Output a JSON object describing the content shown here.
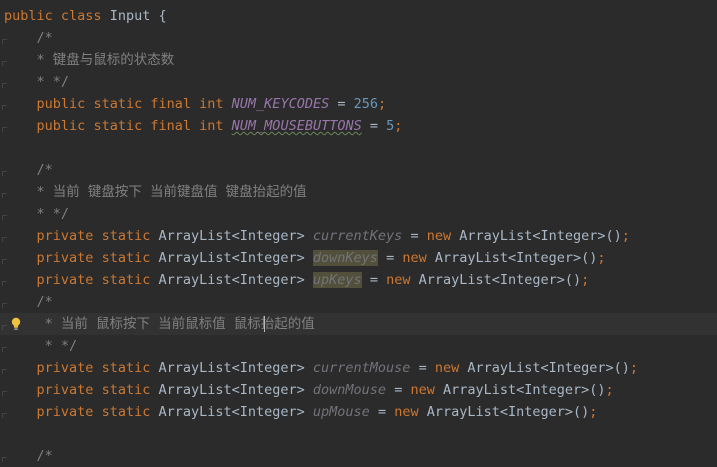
{
  "lines": [
    {
      "t": [
        [
          "public",
          "kw"
        ],
        [
          " ",
          ""
        ],
        [
          "class",
          "kw"
        ],
        [
          " ",
          ""
        ],
        [
          "Input",
          "cname"
        ],
        [
          " {",
          ""
        ]
      ]
    },
    {
      "t": [
        [
          "    /*",
          "cm"
        ]
      ]
    },
    {
      "t": [
        [
          "    * 键盘与鼠标的状态数",
          "cm"
        ]
      ]
    },
    {
      "t": [
        [
          "    * */",
          "cm"
        ]
      ]
    },
    {
      "t": [
        [
          "    ",
          ""
        ],
        [
          "public",
          "kw"
        ],
        [
          " ",
          ""
        ],
        [
          "static",
          "kw"
        ],
        [
          " ",
          ""
        ],
        [
          "final",
          "kw"
        ],
        [
          " ",
          ""
        ],
        [
          "int",
          "kw"
        ],
        [
          " ",
          ""
        ],
        [
          "NUM_KEYCODES",
          "fstatic"
        ],
        [
          " = ",
          ""
        ],
        [
          "256",
          "num"
        ],
        [
          ";",
          "kw"
        ]
      ]
    },
    {
      "t": [
        [
          "    ",
          ""
        ],
        [
          "public",
          "kw"
        ],
        [
          " ",
          ""
        ],
        [
          "static",
          "kw"
        ],
        [
          " ",
          ""
        ],
        [
          "final",
          "kw"
        ],
        [
          " ",
          ""
        ],
        [
          "int",
          "kw"
        ],
        [
          " ",
          ""
        ],
        [
          "NUM_MOUSEBUTTONS",
          "fstatic ul"
        ],
        [
          " = ",
          ""
        ],
        [
          "5",
          "num"
        ],
        [
          ";",
          "kw"
        ]
      ]
    },
    {
      "t": []
    },
    {
      "t": [
        [
          "    /*",
          "cm"
        ]
      ]
    },
    {
      "t": [
        [
          "    * 当前 键盘按下 当前键盘值 键盘抬起的值",
          "cm"
        ]
      ]
    },
    {
      "t": [
        [
          "    * */",
          "cm"
        ]
      ]
    },
    {
      "t": [
        [
          "    ",
          ""
        ],
        [
          "private",
          "kw"
        ],
        [
          " ",
          ""
        ],
        [
          "static",
          "kw"
        ],
        [
          " ArrayList<Integer> ",
          ""
        ],
        [
          "currentKeys",
          "unused"
        ],
        [
          " = ",
          ""
        ],
        [
          "new",
          "kw"
        ],
        [
          " ArrayList<Integer>()",
          ""
        ],
        [
          ";",
          "kw"
        ]
      ]
    },
    {
      "t": [
        [
          "    ",
          ""
        ],
        [
          "private",
          "kw"
        ],
        [
          " ",
          ""
        ],
        [
          "static",
          "kw"
        ],
        [
          " ArrayList<Integer> ",
          ""
        ],
        [
          "downKeys",
          "unused hlb"
        ],
        [
          " = ",
          ""
        ],
        [
          "new",
          "kw"
        ],
        [
          " ArrayList<Integer>()",
          ""
        ],
        [
          ";",
          "kw"
        ]
      ]
    },
    {
      "t": [
        [
          "    ",
          ""
        ],
        [
          "private",
          "kw"
        ],
        [
          " ",
          ""
        ],
        [
          "static",
          "kw"
        ],
        [
          " ArrayList<Integer> ",
          ""
        ],
        [
          "upKeys",
          "unused hlb"
        ],
        [
          " = ",
          ""
        ],
        [
          "new",
          "kw"
        ],
        [
          " ArrayList<Integer>()",
          ""
        ],
        [
          ";",
          "kw"
        ]
      ]
    },
    {
      "t": [
        [
          "    /*",
          "cm"
        ]
      ]
    },
    {
      "t": [
        [
          "     * 当前 鼠标按下 当前鼠标值 鼠标抬起的值",
          "cm"
        ]
      ],
      "current": true
    },
    {
      "t": [
        [
          "     * */",
          "cm"
        ]
      ]
    },
    {
      "t": [
        [
          "    ",
          ""
        ],
        [
          "private",
          "kw"
        ],
        [
          " ",
          ""
        ],
        [
          "static",
          "kw"
        ],
        [
          " ArrayList<Integer> ",
          ""
        ],
        [
          "currentMouse",
          "unused"
        ],
        [
          " = ",
          ""
        ],
        [
          "new",
          "kw"
        ],
        [
          " ArrayList<Integer>()",
          ""
        ],
        [
          ";",
          "kw"
        ]
      ]
    },
    {
      "t": [
        [
          "    ",
          ""
        ],
        [
          "private",
          "kw"
        ],
        [
          " ",
          ""
        ],
        [
          "static",
          "kw"
        ],
        [
          " ArrayList<Integer> ",
          ""
        ],
        [
          "downMouse",
          "unused"
        ],
        [
          " = ",
          ""
        ],
        [
          "new",
          "kw"
        ],
        [
          " ArrayList<Integer>()",
          ""
        ],
        [
          ";",
          "kw"
        ]
      ]
    },
    {
      "t": [
        [
          "    ",
          ""
        ],
        [
          "private",
          "kw"
        ],
        [
          " ",
          ""
        ],
        [
          "static",
          "kw"
        ],
        [
          " ArrayList<Integer> ",
          ""
        ],
        [
          "upMouse",
          "unused"
        ],
        [
          " = ",
          ""
        ],
        [
          "new",
          "kw"
        ],
        [
          " ArrayList<Integer>()",
          ""
        ],
        [
          ";",
          "kw"
        ]
      ]
    },
    {
      "t": []
    },
    {
      "t": [
        [
          "    /*",
          "cm"
        ]
      ]
    }
  ],
  "colors": {
    "background": "#2b2b2b",
    "keyword": "#cc7832",
    "text": "#a9b7c6",
    "comment": "#808080",
    "number": "#6897bb",
    "static_field": "#9876aa",
    "unused_field": "#72737a",
    "current_line": "#323232",
    "bulb": "#f0c040"
  },
  "icons": {
    "gutter_hint": "lightbulb-icon"
  }
}
